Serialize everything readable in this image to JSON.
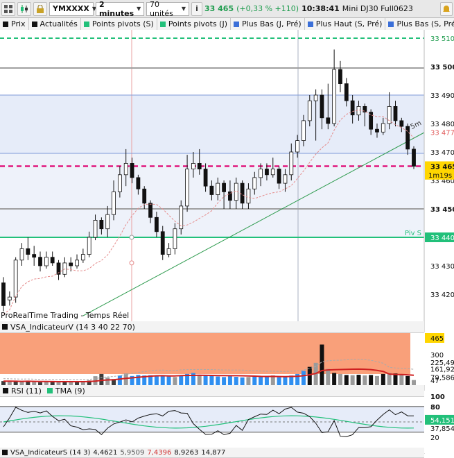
{
  "toolbar": {
    "symbol": "YMXXXX",
    "timeframe": "2 minutes",
    "units": "70 unités",
    "price": "33 465",
    "change": "(+0,33 % +110)",
    "time": "10:38:41",
    "instrument": "Mini DJ30 Full0623"
  },
  "legend": [
    {
      "label": "Prix",
      "color": "#111111"
    },
    {
      "label": "Actualités",
      "color": "#111111"
    },
    {
      "label": "Points pivots (S)",
      "color": "#22c07a"
    },
    {
      "label": "Points pivots (J)",
      "color": "#22c07a"
    },
    {
      "label": "Plus Bas (J, Pré)",
      "color": "#3b6fd8"
    },
    {
      "label": "Plus Haut (S, Pré)",
      "color": "#3b6fd8"
    },
    {
      "label": "Plus Bas (S, Pré)",
      "color": "#3b6fd8"
    }
  ],
  "price_pane": {
    "axis": [
      "33 510",
      "33 500",
      "33 490",
      "33 480",
      "33 477",
      "33 470",
      "33 465",
      "33 460",
      "33 450",
      "33 440",
      "33 430",
      "33 420"
    ],
    "current_price": "33 465",
    "pivot_price": "33 477",
    "countdown": "1m19s",
    "pivot_label": "Piv S",
    "ma_label": "5m",
    "watermark": "ProRealTime Trading - Temps Réel"
  },
  "vsa_pane": {
    "title": "VSA_IndicateurV (14 3 40 22 70)",
    "axis": [
      "465",
      "300",
      "225,49",
      "161,92",
      "79,586",
      "47"
    ]
  },
  "rsi_pane": {
    "legend": [
      {
        "label": "RSI (11)",
        "color": "#111111"
      },
      {
        "label": "TMA (9)",
        "color": "#22c07a"
      }
    ],
    "axis": [
      "100",
      "80",
      "54,151",
      "37,854",
      "20"
    ]
  },
  "bottom_legend": {
    "title": "VSA_IndicateurS (14 3)",
    "values": [
      "4,4621",
      "5,9509",
      "7,4396",
      "8,9263",
      "14,877"
    ]
  },
  "colors": {
    "accent_green": "#22c07a",
    "pivot_magenta": "#e0187c",
    "vsa_fill": "#f9a07a",
    "volume_blue": "#2f8ff0"
  }
}
